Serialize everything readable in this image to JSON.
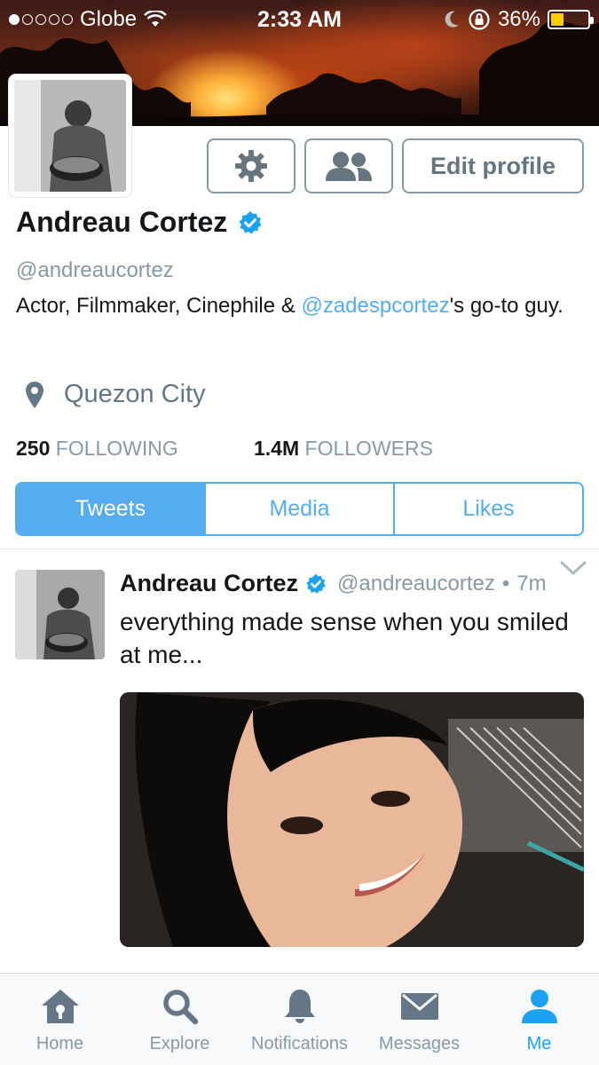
{
  "status_bar": {
    "carrier": "Globe",
    "time": "2:33 AM",
    "battery": "36%",
    "battery_level": 0.36,
    "signal_bars_filled": 1,
    "signal_bars_total": 5,
    "icons": [
      "wifi-icon",
      "do-not-disturb-moon-icon",
      "rotation-lock-icon",
      "battery-icon"
    ]
  },
  "profile": {
    "name": "Andreau Cortez",
    "verified": true,
    "handle": "@andreaucortez",
    "bio_before": "Actor, Filmmaker, Cinephile & ",
    "bio_mention": "@zadespcortez",
    "bio_after": "'s go-to guy.",
    "location": "Quezon City",
    "following_count": "250",
    "following_label": "FOLLOWING",
    "followers_count": "1.4M",
    "followers_label": "FOLLOWERS"
  },
  "actions": {
    "settings_icon": "gear-icon",
    "follow_icon": "people-icon",
    "edit_profile_label": "Edit profile"
  },
  "tabs": [
    {
      "label": "Tweets",
      "active": true
    },
    {
      "label": "Media",
      "active": false
    },
    {
      "label": "Likes",
      "active": false
    }
  ],
  "tweet": {
    "name": "Andreau Cortez",
    "handle": "@andreaucortez",
    "separator": "•",
    "time": "7m",
    "text": "everything made sense when you smiled at me..."
  },
  "tabbar": [
    {
      "label": "Home",
      "icon": "home-icon",
      "active": false
    },
    {
      "label": "Explore",
      "icon": "search-icon",
      "active": false
    },
    {
      "label": "Notifications",
      "icon": "bell-icon",
      "active": false
    },
    {
      "label": "Messages",
      "icon": "envelope-icon",
      "active": false
    },
    {
      "label": "Me",
      "icon": "person-icon",
      "active": true
    }
  ],
  "colors": {
    "accent": "#55acee",
    "text": "#14171a",
    "muted": "#8899a6",
    "battery": "#ffcc00"
  }
}
